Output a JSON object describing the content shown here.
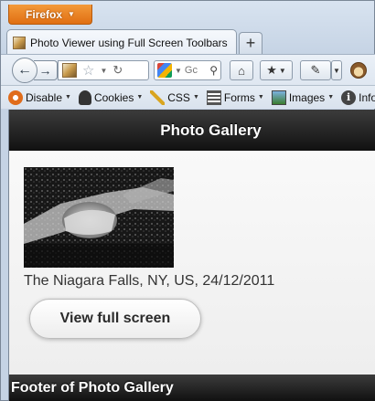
{
  "browser": {
    "app_button_label": "Firefox",
    "tab": {
      "title": "Photo Viewer using Full Screen Toolbars"
    },
    "new_tab_label": "+",
    "search": {
      "placeholder": "Gc"
    },
    "icons": {
      "app_menu_caret": "triangle-down",
      "back": "arrow-left",
      "forward": "arrow-right",
      "bookmark_star": "star",
      "reload": "reload",
      "search": "magnifier",
      "home": "house",
      "bookmarks": "bookmarks-star",
      "devtools": "pipette",
      "addon": "monkey-face"
    }
  },
  "dev_toolbar": {
    "items": [
      {
        "label": "Disable",
        "icon": "disable-icon"
      },
      {
        "label": "Cookies",
        "icon": "cookies-icon"
      },
      {
        "label": "CSS",
        "icon": "css-icon"
      },
      {
        "label": "Forms",
        "icon": "forms-icon"
      },
      {
        "label": "Images",
        "icon": "images-icon"
      },
      {
        "label": "Inforn",
        "icon": "info-icon"
      }
    ]
  },
  "page": {
    "header_title": "Photo Gallery",
    "photo_caption": "The Niagara Falls, NY, US, 24/12/2011",
    "fullscreen_button_label": "View full screen",
    "footer_title": "Footer of Photo Gallery"
  },
  "colors": {
    "firefox_button": "#e8821e",
    "bar_background": "#1a1a1a",
    "bar_text": "#ffffff"
  }
}
